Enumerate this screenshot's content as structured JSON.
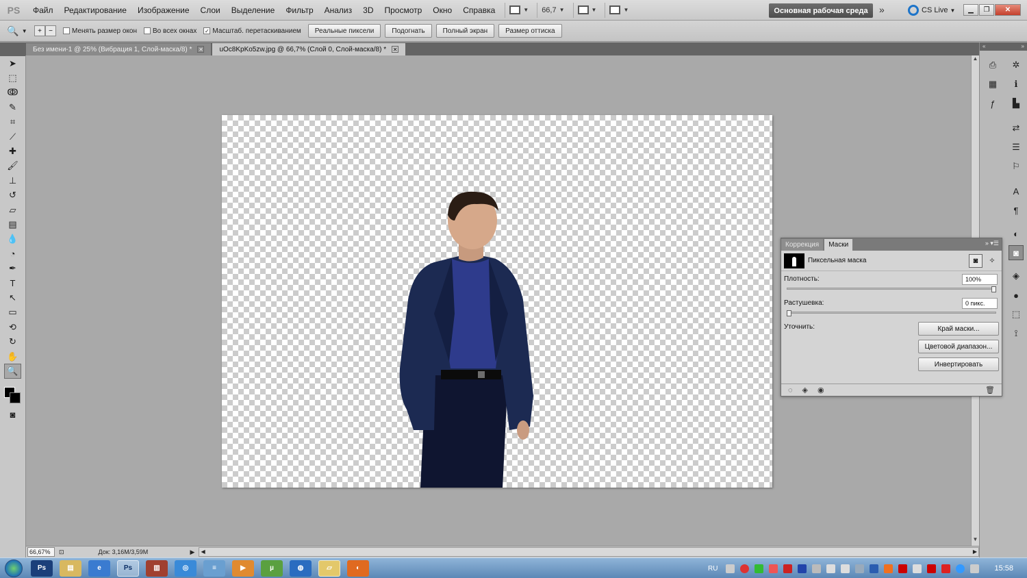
{
  "app": {
    "logo": "PS"
  },
  "menu": [
    "Файл",
    "Редактирование",
    "Изображение",
    "Слои",
    "Выделение",
    "Фильтр",
    "Анализ",
    "3D",
    "Просмотр",
    "Окно",
    "Справка"
  ],
  "menubar": {
    "zoom_value": "66,7",
    "workspace": "Основная рабочая среда",
    "cslive": "CS Live"
  },
  "options": {
    "resize_windows": "Менять размер окон",
    "all_windows": "Во всех окнах",
    "scrubby_zoom": "Масштаб. перетаскиванием",
    "actual_pixels": "Реальные пиксели",
    "fit_screen": "Подогнать",
    "fill_screen": "Полный экран",
    "print_size": "Размер оттиска"
  },
  "tabs": [
    {
      "label": "Без имени-1 @ 25% (Вибрация 1, Слой-маска/8) *"
    },
    {
      "label": "uOc8KpKo5zw.jpg @ 66,7% (Слой 0, Слой-маска/8) *"
    }
  ],
  "status": {
    "zoom": "66,67%",
    "doc": "Док: 3,16M/3,59M"
  },
  "masks_panel": {
    "tab_correction": "Коррекция",
    "tab_masks": "Маски",
    "mask_type": "Пиксельная маска",
    "density_label": "Плотность:",
    "density_value": "100%",
    "density_level": 1.0,
    "feather_label": "Растушевка:",
    "feather_value": "0 пикс.",
    "feather_level": 0.0,
    "refine_label": "Уточнить:",
    "btn_mask_edge": "Край маски...",
    "btn_color_range": "Цветовой диапазон...",
    "btn_invert": "Инвертировать"
  },
  "taskbar": {
    "language": "RU",
    "clock": "15:58",
    "apps": [
      "ps-launcher",
      "explorer",
      "internet-explorer",
      "photoshop",
      "archive",
      "messenger",
      "notepad",
      "media-player",
      "torrent",
      "browser",
      "folder",
      "firefox"
    ]
  },
  "colors": {
    "checker": "#cccccc",
    "suit": "#1c2a52",
    "shirt": "#2e3b8c",
    "taskbar": "#5c88b6"
  }
}
